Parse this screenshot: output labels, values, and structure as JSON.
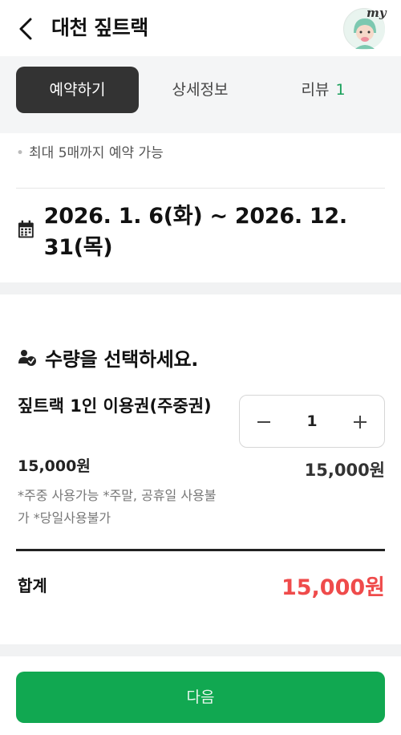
{
  "header": {
    "title": "대천 짚트랙",
    "avatar_label": "my"
  },
  "tabs": [
    {
      "label": "예약하기",
      "active": true
    },
    {
      "label": "상세정보",
      "active": false
    },
    {
      "label": "리뷰",
      "count": "1",
      "active": false
    }
  ],
  "notice": "최대 5매까지 예약 가능",
  "date_range": "2026. 1. 6(화) ~ 2026. 12. 31(목)",
  "quantity_section": {
    "title": "수량을 선택하세요."
  },
  "item": {
    "name": "짚트랙 1인 이용권(주중권)",
    "price": "15,000원",
    "note": "*주중 사용가능 *주말, 공휴일 사용불가 *당일사용불가",
    "quantity": "1",
    "line_total": "15,000원"
  },
  "summary": {
    "label": "합계",
    "value": "15,000원"
  },
  "next_button": "다음",
  "colors": {
    "accent_green": "#11a851",
    "total_red": "#ef4b4b",
    "active_tab_bg": "#333333"
  }
}
